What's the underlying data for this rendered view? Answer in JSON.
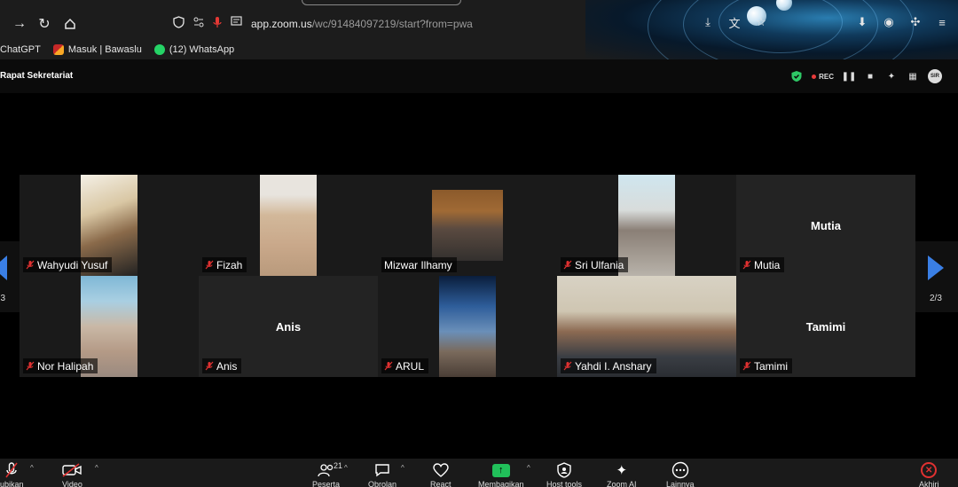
{
  "browser": {
    "url_host": "app.zoom.us",
    "url_path": "/wc/91484097219/start?from=pwa",
    "bookmarks": [
      {
        "label": "ChatGPT"
      },
      {
        "label": "Masuk | Bawaslu"
      },
      {
        "label": "(12) WhatsApp"
      }
    ]
  },
  "meeting": {
    "title": "Rapat Sekretariat",
    "rec_label": "REC",
    "avatar_initials": "SIR"
  },
  "pager": {
    "left_count": "3",
    "right_count": "2/3"
  },
  "participants": [
    {
      "name": "Wahyudi Yusuf",
      "video": true
    },
    {
      "name": "Fizah",
      "video": true
    },
    {
      "name": "Mizwar Ilhamy",
      "video": true
    },
    {
      "name": "Sri Ulfania",
      "video": true
    },
    {
      "name": "Mutia",
      "video": false,
      "big_name": "Mutia"
    },
    {
      "name": "Nor Halipah",
      "video": true
    },
    {
      "name": "Anis",
      "video": false,
      "big_name": "Anis"
    },
    {
      "name": "ARUL",
      "video": true
    },
    {
      "name": "Yahdi I. Anshary",
      "video": true
    },
    {
      "name": "Tamimi",
      "video": false,
      "big_name": "Tamimi"
    }
  ],
  "toolbar": {
    "audio_label": "ubikan",
    "video_label": "Video",
    "participants_label": "Peserta",
    "participants_count": "21",
    "chat_label": "Obrolan",
    "react_label": "React",
    "share_label": "Membagikan",
    "host_tools_label": "Host tools",
    "zoom_ai_label": "Zoom AI",
    "more_label": "Lainnya",
    "end_label": "Akhiri"
  },
  "colors": {
    "accent_blue": "#3a7fe5",
    "share_green": "#21c05a",
    "end_red": "#e03131",
    "rec_red": "#e83b3b",
    "shield_green": "#2ec866"
  }
}
